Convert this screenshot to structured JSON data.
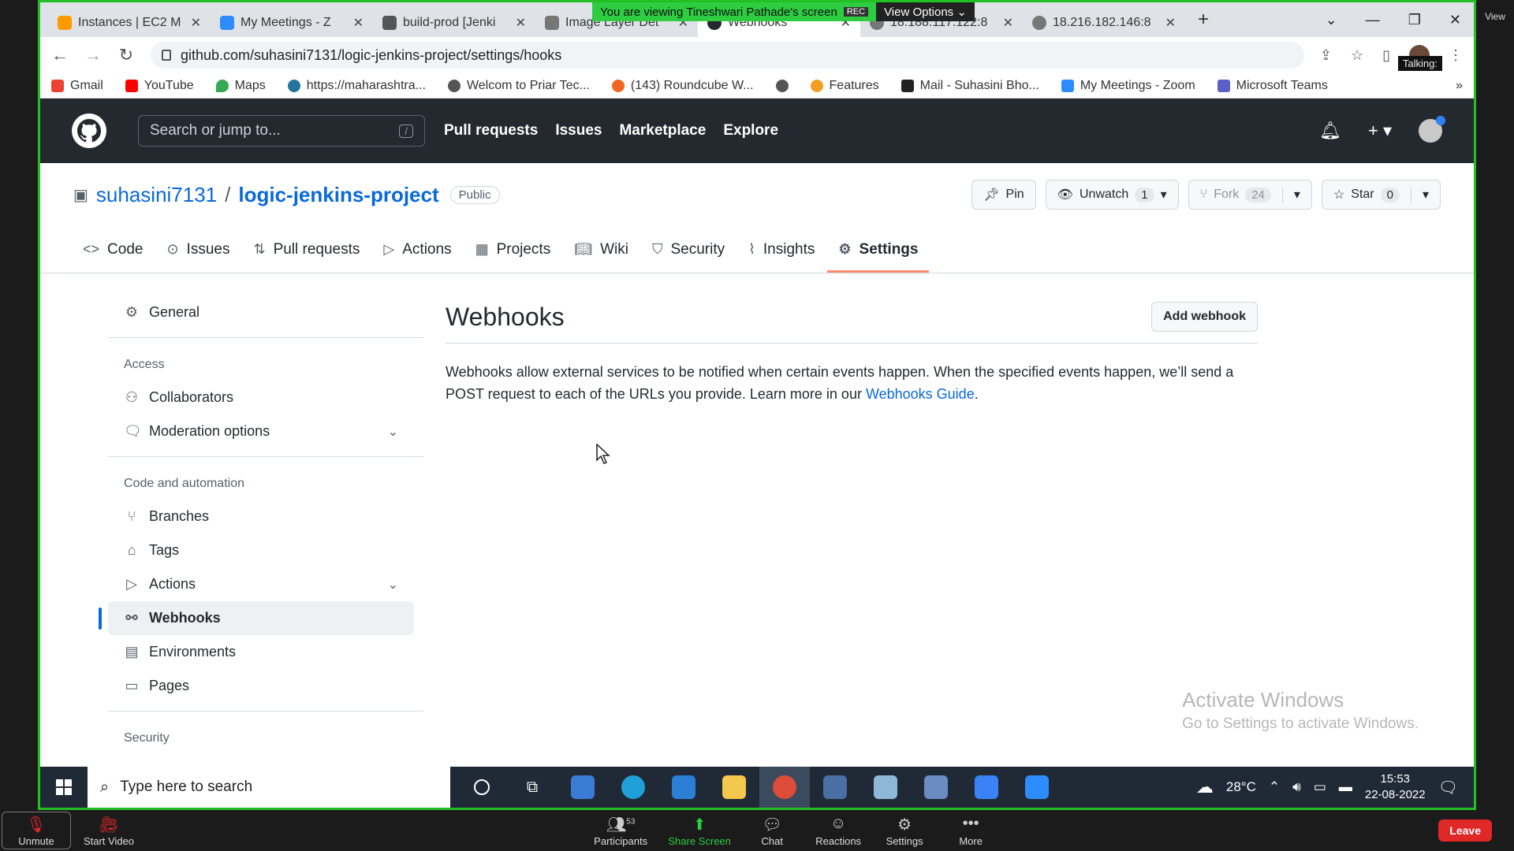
{
  "zoom": {
    "banner_text": "You are viewing Tineshwari Pathade's screen",
    "rec_label": "REC",
    "view_options_label": "View Options",
    "talking_label": "Talking:",
    "view_label": "View",
    "toolbar": [
      {
        "label": "Unmute",
        "icon": "microphone-muted-icon"
      },
      {
        "label": "Start Video",
        "icon": "video-off-icon"
      }
    ],
    "center_toolbar": [
      {
        "label": "Participants",
        "badge": "53",
        "icon": "participants-icon"
      },
      {
        "label": "Share Screen",
        "icon": "share-screen-icon"
      },
      {
        "label": "Chat",
        "icon": "chat-icon"
      },
      {
        "label": "Reactions",
        "icon": "reactions-icon"
      },
      {
        "label": "Settings",
        "icon": "settings-icon"
      },
      {
        "label": "More",
        "icon": "more-icon"
      }
    ],
    "leave_label": "Leave"
  },
  "browser": {
    "tabs": [
      {
        "label": "Instances | EC2 M",
        "active": false,
        "color": "#f90"
      },
      {
        "label": "My Meetings - Z",
        "active": false,
        "color": "#2d8cff"
      },
      {
        "label": "build-prod [Jenki",
        "active": false,
        "color": "#555"
      },
      {
        "label": "Image Layer Det",
        "active": false,
        "color": "#777"
      },
      {
        "label": "Webhooks",
        "active": true,
        "color": "#24292f"
      },
      {
        "label": "18.188.117.122:8",
        "active": false,
        "color": "#777"
      },
      {
        "label": "18.216.182.146:8",
        "active": false,
        "color": "#777"
      }
    ],
    "url": "github.com/suhasini7131/logic-jenkins-project/settings/hooks",
    "bookmarks": [
      {
        "label": "Gmail",
        "color": "#ea4335"
      },
      {
        "label": "YouTube",
        "color": "#ff0000"
      },
      {
        "label": "Maps",
        "color": "#34a853"
      },
      {
        "label": "https://maharashtra...",
        "color": "#21759b"
      },
      {
        "label": "Welcom to Priar Tec...",
        "color": "#555"
      },
      {
        "label": "(143) Roundcube W...",
        "color": "#f26522"
      },
      {
        "label": "",
        "color": "#555"
      },
      {
        "label": "Features",
        "color": "#f0a020"
      },
      {
        "label": "Mail - Suhasini Bho...",
        "color": "#222"
      },
      {
        "label": "My Meetings - Zoom",
        "color": "#2d8cff"
      },
      {
        "label": "Microsoft Teams",
        "color": "#5b5fc7"
      }
    ]
  },
  "github": {
    "search_placeholder": "Search or jump to...",
    "search_shortcut": "/",
    "nav": [
      "Pull requests",
      "Issues",
      "Marketplace",
      "Explore"
    ],
    "repo": {
      "owner": "suhasini7131",
      "separator": "/",
      "name": "logic-jenkins-project",
      "visibility": "Public"
    },
    "actions": {
      "pin": "Pin",
      "unwatch": "Unwatch",
      "unwatch_count": "1",
      "fork": "Fork",
      "fork_count": "24",
      "star": "Star",
      "star_count": "0"
    },
    "tabs": [
      {
        "label": "Code",
        "icon": "code-icon"
      },
      {
        "label": "Issues",
        "icon": "issue-icon"
      },
      {
        "label": "Pull requests",
        "icon": "pull-request-icon"
      },
      {
        "label": "Actions",
        "icon": "play-icon"
      },
      {
        "label": "Projects",
        "icon": "table-icon"
      },
      {
        "label": "Wiki",
        "icon": "book-icon"
      },
      {
        "label": "Security",
        "icon": "shield-icon"
      },
      {
        "label": "Insights",
        "icon": "graph-icon"
      },
      {
        "label": "Settings",
        "icon": "gear-icon",
        "active": true
      }
    ],
    "sidenav": {
      "general": "General",
      "access_heading": "Access",
      "collaborators": "Collaborators",
      "moderation": "Moderation options",
      "code_heading": "Code and automation",
      "branches": "Branches",
      "tags": "Tags",
      "actions": "Actions",
      "webhooks": "Webhooks",
      "environments": "Environments",
      "pages": "Pages",
      "security_heading": "Security"
    },
    "main": {
      "title": "Webhooks",
      "add_button": "Add webhook",
      "description": "Webhooks allow external services to be notified when certain events happen. When the specified events happen, we’ll send a POST request to each of the URLs you provide. Learn more in our ",
      "link_text": "Webhooks Guide",
      "period": "."
    }
  },
  "windows": {
    "watermark_title": "Activate Windows",
    "watermark_sub": "Go to Settings to activate Windows.",
    "search_placeholder": "Type here to search",
    "temperature": "28°C",
    "time": "15:53",
    "date": "22-08-2022"
  }
}
